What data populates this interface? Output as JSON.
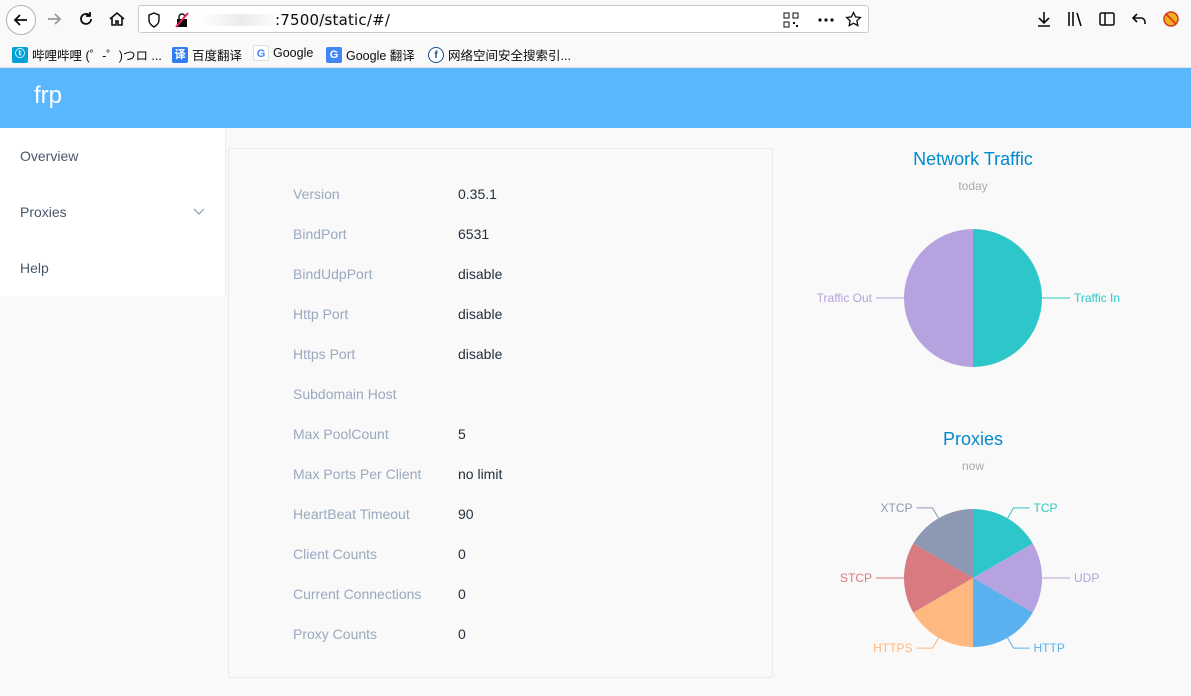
{
  "browser": {
    "url_suffix": ":7500/static/#/",
    "bookmarks": [
      {
        "label": "哔哩哔哩 (゜-゜)つロ ...",
        "icon": "bilibili-icon"
      },
      {
        "label": "百度翻译",
        "icon": "baidu-translate-icon"
      },
      {
        "label": "Google",
        "icon": "google-icon"
      },
      {
        "label": "Google 翻译",
        "icon": "google-translate-icon"
      },
      {
        "label": "网络空间安全搜索引...",
        "icon": "search-engine-icon"
      }
    ]
  },
  "app": {
    "brand": "frp"
  },
  "sidebar": {
    "items": [
      {
        "label": "Overview"
      },
      {
        "label": "Proxies"
      },
      {
        "label": "Help"
      }
    ]
  },
  "overview": {
    "rows": [
      {
        "key": "Version",
        "value": "0.35.1"
      },
      {
        "key": "BindPort",
        "value": "6531"
      },
      {
        "key": "BindUdpPort",
        "value": "disable"
      },
      {
        "key": "Http Port",
        "value": "disable"
      },
      {
        "key": "Https Port",
        "value": "disable"
      },
      {
        "key": "Subdomain Host",
        "value": ""
      },
      {
        "key": "Max PoolCount",
        "value": "5"
      },
      {
        "key": "Max Ports Per Client",
        "value": "no limit"
      },
      {
        "key": "HeartBeat Timeout",
        "value": "90"
      },
      {
        "key": "Client Counts",
        "value": "0"
      },
      {
        "key": "Current Connections",
        "value": "0"
      },
      {
        "key": "Proxy Counts",
        "value": "0"
      }
    ]
  },
  "chart_data": [
    {
      "type": "pie",
      "title": "Network Traffic",
      "subtitle": "today",
      "categories": [
        "Traffic In",
        "Traffic Out"
      ],
      "values": [
        1,
        1
      ],
      "colors": [
        "#2ec7c9",
        "#b6a2de"
      ]
    },
    {
      "type": "pie",
      "title": "Proxies",
      "subtitle": "now",
      "categories": [
        "TCP",
        "UDP",
        "HTTP",
        "HTTPS",
        "STCP",
        "XTCP"
      ],
      "values": [
        1,
        1,
        1,
        1,
        1,
        1
      ],
      "colors": [
        "#2ec7c9",
        "#b6a2de",
        "#5ab1ef",
        "#ffb980",
        "#d87a80",
        "#8d98b3"
      ]
    }
  ]
}
